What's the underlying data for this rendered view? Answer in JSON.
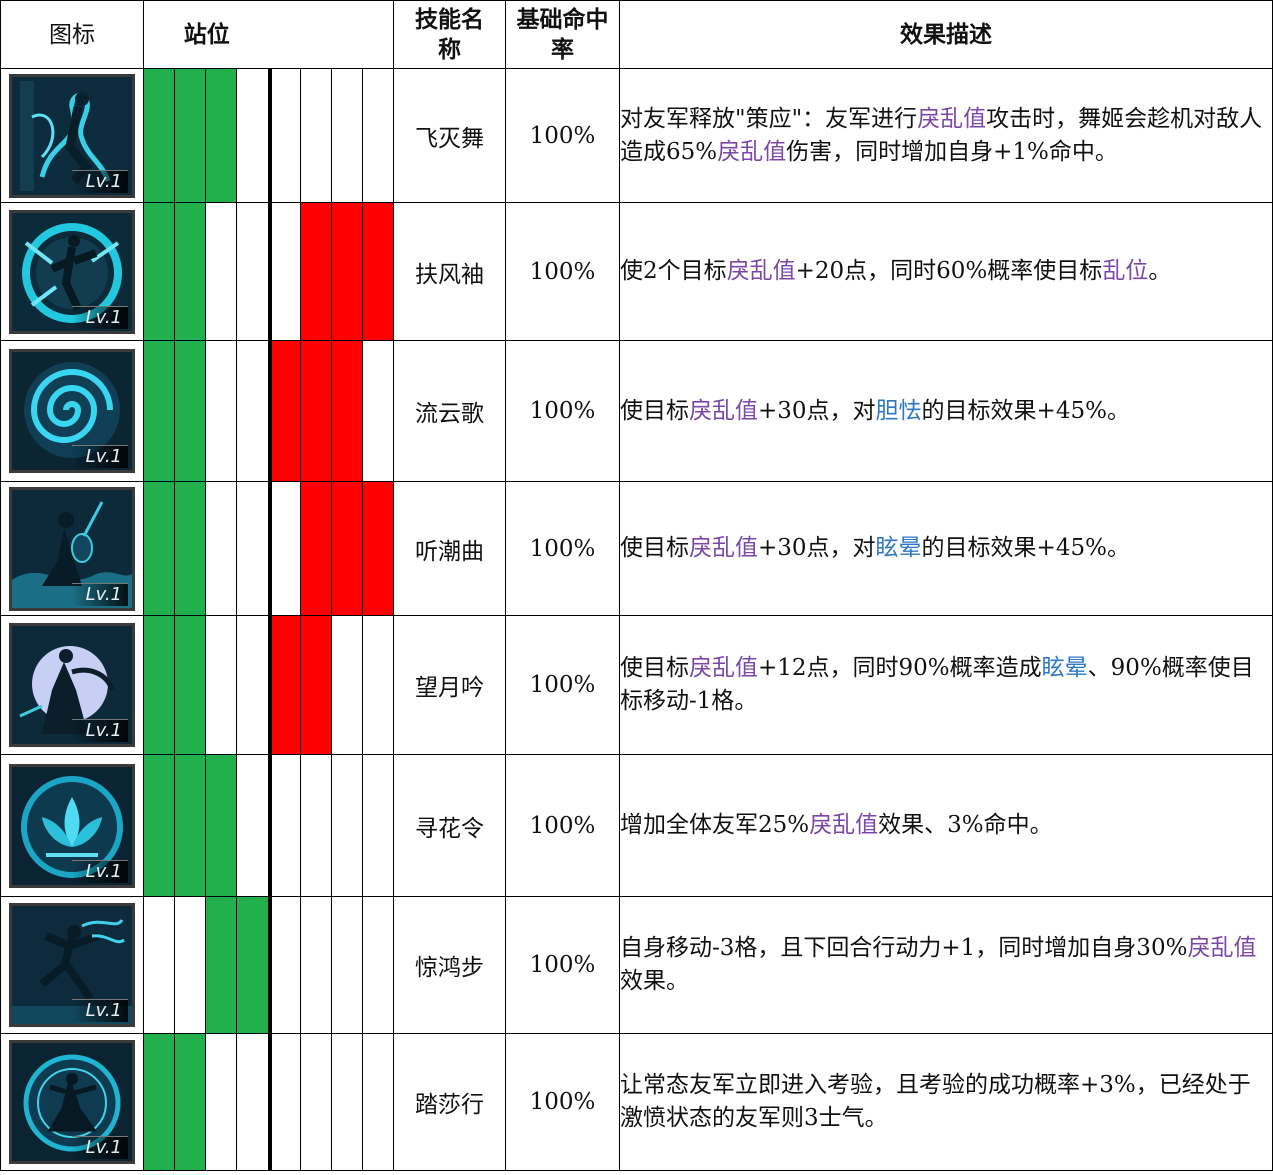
{
  "header": {
    "icon": "图标",
    "position": "站位",
    "skill_name": "技能名称",
    "base_hit": "基础命中率",
    "effect": "效果描述"
  },
  "level_badge": "Lv.1",
  "position_colors": {
    "own": "#21b04b",
    "target": "#ff0000",
    "empty": "#ffffff"
  },
  "keyword_colors": {
    "purple": "#7b48a8",
    "blue": "#2f78c3"
  },
  "rows": [
    {
      "icon": "dancer-ribbon-icon",
      "name": "飞灭舞",
      "rate": "100%",
      "own": [
        1,
        1,
        1,
        0
      ],
      "target": [
        0,
        0,
        0,
        0
      ],
      "desc": [
        {
          "t": "对友军释放\"策应\"：友军进行"
        },
        {
          "t": "戾乱值",
          "c": "purple"
        },
        {
          "t": "攻击时，舞姬会趁机对敌人造成65%"
        },
        {
          "t": "戾乱值",
          "c": "purple"
        },
        {
          "t": "伤害，同时增加自身+1%命中。"
        }
      ]
    },
    {
      "icon": "dancer-sleeve-icon",
      "name": "扶风袖",
      "rate": "100%",
      "own": [
        1,
        1,
        0,
        0
      ],
      "target": [
        0,
        1,
        1,
        1
      ],
      "desc": [
        {
          "t": "使2个目标"
        },
        {
          "t": "戾乱值",
          "c": "purple"
        },
        {
          "t": "+20点，同时60%概率使目标"
        },
        {
          "t": "乱位",
          "c": "purple"
        },
        {
          "t": "。"
        }
      ]
    },
    {
      "icon": "swirl-cloud-icon",
      "name": "流云歌",
      "rate": "100%",
      "own": [
        1,
        1,
        0,
        0
      ],
      "target": [
        1,
        1,
        1,
        0
      ],
      "desc": [
        {
          "t": "使目标"
        },
        {
          "t": "戾乱值",
          "c": "purple"
        },
        {
          "t": "+30点，对"
        },
        {
          "t": "胆怯",
          "c": "blue"
        },
        {
          "t": "的目标效果+45%。"
        }
      ]
    },
    {
      "icon": "lute-player-icon",
      "name": "听潮曲",
      "rate": "100%",
      "own": [
        1,
        1,
        0,
        0
      ],
      "target": [
        0,
        1,
        1,
        1
      ],
      "desc": [
        {
          "t": "使目标"
        },
        {
          "t": "戾乱值",
          "c": "purple"
        },
        {
          "t": "+30点，对"
        },
        {
          "t": "眩晕",
          "c": "blue"
        },
        {
          "t": "的目标效果+45%。"
        }
      ]
    },
    {
      "icon": "moon-dancer-icon",
      "name": "望月吟",
      "rate": "100%",
      "own": [
        1,
        1,
        0,
        0
      ],
      "target": [
        1,
        1,
        0,
        0
      ],
      "desc": [
        {
          "t": "使目标"
        },
        {
          "t": "戾乱值",
          "c": "purple"
        },
        {
          "t": "+12点，同时90%概率造成"
        },
        {
          "t": "眩晕",
          "c": "blue"
        },
        {
          "t": "、90%概率使目标移动-1格。"
        }
      ]
    },
    {
      "icon": "lotus-flower-icon",
      "name": "寻花令",
      "rate": "100%",
      "own": [
        1,
        1,
        1,
        0
      ],
      "target": [
        0,
        0,
        0,
        0
      ],
      "desc": [
        {
          "t": "增加全体友军25%"
        },
        {
          "t": "戾乱值",
          "c": "purple"
        },
        {
          "t": "效果、3%命中。"
        }
      ]
    },
    {
      "icon": "leaping-dancer-icon",
      "name": "惊鸿步",
      "rate": "100%",
      "own": [
        0,
        0,
        1,
        1
      ],
      "target": [
        0,
        0,
        0,
        0
      ],
      "desc": [
        {
          "t": "自身移动-3格，且下回合行动力+1，同时增加自身30%"
        },
        {
          "t": "戾乱值",
          "c": "purple"
        },
        {
          "t": "效果。"
        }
      ]
    },
    {
      "icon": "circle-dancer-icon",
      "name": "踏莎行",
      "rate": "100%",
      "own": [
        1,
        1,
        0,
        0
      ],
      "target": [
        0,
        0,
        0,
        0
      ],
      "desc": [
        {
          "t": "让常态友军立即进入考验，且考验的成功概率+3%，已经处于激愤状态的友军则3士气。"
        }
      ]
    }
  ]
}
